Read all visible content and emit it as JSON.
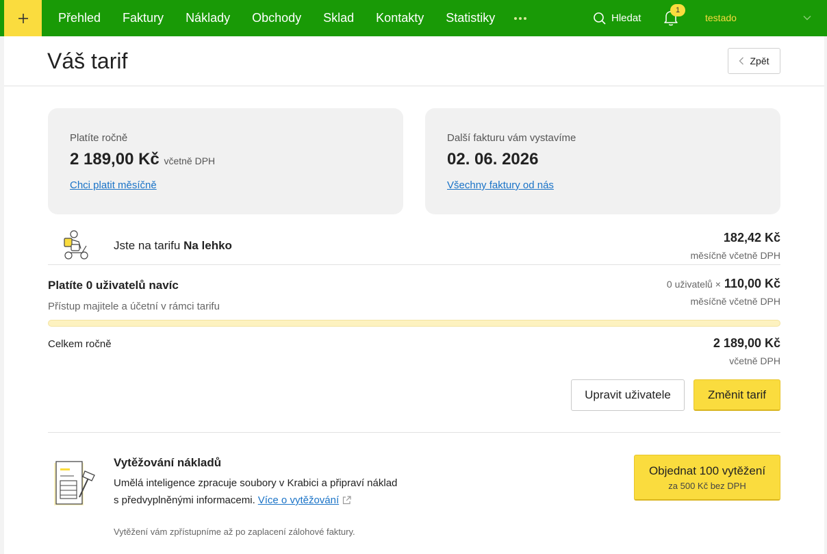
{
  "topbar": {
    "nav": [
      "Přehled",
      "Faktury",
      "Náklady",
      "Obchody",
      "Sklad",
      "Kontakty",
      "Statistiky"
    ],
    "search_label": "Hledat",
    "notifications_count": "1",
    "username": "testado"
  },
  "header": {
    "title": "Váš tarif",
    "back_label": "Zpět"
  },
  "billing": {
    "pay_label": "Platíte ročně",
    "pay_value": "2 189,00 Kč",
    "pay_suffix": "včetně DPH",
    "pay_link": "Chci platit měsíčně",
    "next_label": "Další fakturu vám vystavíme",
    "next_value": "02. 06. 2026",
    "next_link": "Všechny faktury od nás"
  },
  "plan": {
    "prefix": "Jste na tarifu",
    "name": "Na lehko",
    "price": "182,42 Kč",
    "price_note": "měsíčně včetně DPH"
  },
  "users": {
    "title": "Platíte 0 uživatelů navíc",
    "subtitle": "Přístup majitele a účetní v rámci tarifu",
    "count_text": "0 uživatelů ×",
    "price": "110,00 Kč",
    "price_note": "měsíčně včetně DPH",
    "progress_percent": 0
  },
  "total": {
    "label": "Celkem ročně",
    "value": "2 189,00 Kč",
    "note": "včetně DPH"
  },
  "actions": {
    "edit_users": "Upravit uživatele",
    "change_plan": "Změnit tarif"
  },
  "extraction": {
    "title": "Vytěžování nákladů",
    "desc1": "Umělá inteligence zpracuje soubory v Krabici a připraví náklad",
    "desc2": "s předvyplněnými informacemi.",
    "link": "Více o vytěžování",
    "note": "Vytěžení vám zpřístupníme až po zaplacení zálohové faktury.",
    "order_main": "Objednat 100 vytěžení",
    "order_sub": "za 500 Kč bez DPH"
  },
  "colors": {
    "topbar": "#199a06",
    "accent": "#fadc3e",
    "link": "#1a73c7"
  }
}
